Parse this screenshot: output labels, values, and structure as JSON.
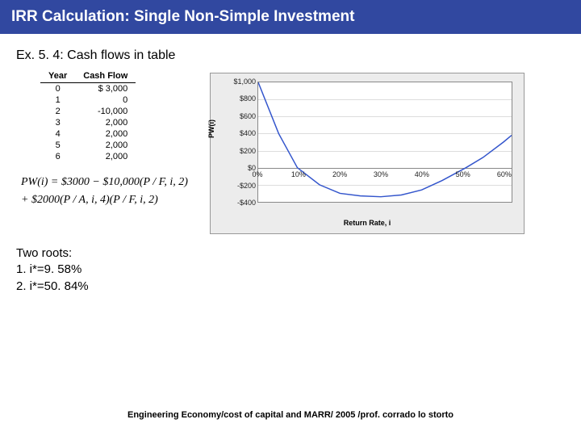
{
  "title": "IRR Calculation:  Single Non-Simple Investment",
  "subtitle": "Ex. 5. 4: Cash flows in table",
  "table": {
    "head_year": "Year",
    "head_cash": "Cash Flow",
    "rows": [
      {
        "year": "0",
        "val": "$   3,000"
      },
      {
        "year": "1",
        "val": "0"
      },
      {
        "year": "2",
        "val": "-10,000"
      },
      {
        "year": "3",
        "val": "2,000"
      },
      {
        "year": "4",
        "val": "2,000"
      },
      {
        "year": "5",
        "val": "2,000"
      },
      {
        "year": "6",
        "val": "2,000"
      }
    ]
  },
  "formula": {
    "line1": "PW(i) = $3000 − $10,000(P / F, i, 2)",
    "line2": "+ $2000(P / A, i, 4)(P / F, i, 2)"
  },
  "roots": {
    "heading": "Two roots:",
    "r1": "1.  i*=9. 58%",
    "r2": "2.  i*=50. 84%"
  },
  "footer": "Engineering Economy/cost of capital and MARR/ 2005 /prof. corrado lo storto",
  "chart_data": {
    "type": "line",
    "xlabel": "Return Rate, i",
    "ylabel": "PW(i)",
    "ylim": [
      -400,
      1000
    ],
    "xlim": [
      0,
      62
    ],
    "y_ticks": [
      "$1,000",
      "$800",
      "$600",
      "$400",
      "$200",
      "$0",
      "-$200",
      "-$400"
    ],
    "x_ticks": [
      "0%",
      "10%",
      "20%",
      "30%",
      "40%",
      "50%",
      "60%"
    ],
    "series": [
      {
        "name": "PW(i)",
        "color": "#3355cc",
        "x": [
          0,
          5,
          9.58,
          15,
          20,
          25,
          30,
          35,
          40,
          45,
          50.84,
          55,
          60,
          62
        ],
        "y": [
          1000,
          400,
          0,
          -200,
          -300,
          -330,
          -340,
          -320,
          -260,
          -150,
          0,
          120,
          300,
          380
        ]
      }
    ]
  }
}
